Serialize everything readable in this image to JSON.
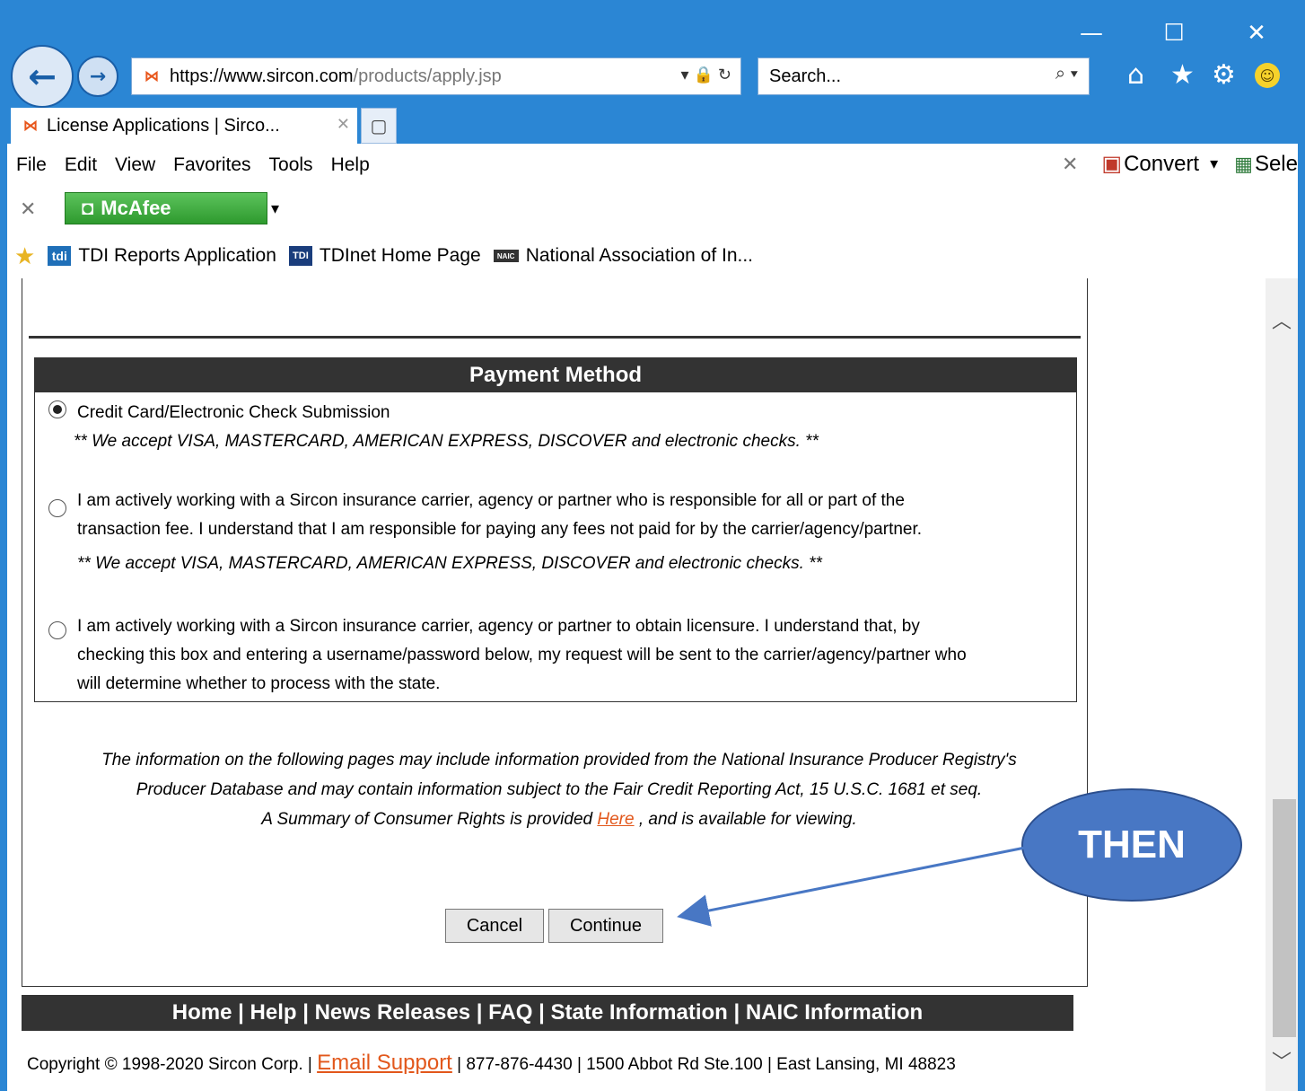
{
  "window": {
    "minimize_glyph": "—",
    "maximize_glyph": "☐",
    "close_glyph": "✕"
  },
  "nav": {
    "back_glyph": "←",
    "forward_glyph": "→",
    "url_domain": "https://www.sircon.com",
    "url_path": "/products/apply.jsp",
    "address_icons": "▾ 🔒 ↻",
    "search_placeholder": "Search...",
    "search_icon": "⌕ ▾",
    "home_icon": "⌂",
    "star_icon": "★",
    "gear_icon": "⚙",
    "smiley_icon": "☺"
  },
  "tab": {
    "title": "License Applications | Sirco...",
    "close_glyph": "✕",
    "new_tab_glyph": "▢"
  },
  "menu": {
    "file": "File",
    "edit": "Edit",
    "view": "View",
    "favorites": "Favorites",
    "tools": "Tools",
    "help": "Help",
    "x_glyph": "✕",
    "convert": "Convert",
    "convert_arrow": "▾",
    "select": "Sele"
  },
  "mcafee": {
    "x_glyph": "✕",
    "label": "McAfee",
    "arrow": "▾"
  },
  "favorites": [
    {
      "label": "TDI Reports Application"
    },
    {
      "label": "TDInet Home Page"
    },
    {
      "label": "National Association of In..."
    }
  ],
  "payment": {
    "title": "Payment Method",
    "options": [
      {
        "selected": true,
        "text": "Credit Card/Electronic Check Submission",
        "note": "** We accept VISA, MASTERCARD, AMERICAN EXPRESS, DISCOVER and electronic checks. **"
      },
      {
        "selected": false,
        "line1": "I am actively working with a Sircon insurance carrier, agency or partner who is responsible for all or part of the",
        "line2": "transaction fee. I understand that I am responsible for paying any fees not paid for by the carrier/agency/partner.",
        "note": "** We accept VISA, MASTERCARD, AMERICAN EXPRESS, DISCOVER and electronic checks. **"
      },
      {
        "selected": false,
        "line1": "I am actively working with a Sircon insurance carrier, agency or partner to obtain licensure. I understand that, by",
        "line2": "checking this box and entering a username/password below, my request will be sent to the carrier/agency/partner who",
        "line3": "will determine whether to process with the state."
      }
    ]
  },
  "notice": {
    "line1": "The information on the following pages may include information provided from the National Insurance Producer Registry's",
    "line2": "Producer Database and may contain information subject to the Fair Credit Reporting Act, 15 U.S.C. 1681 et seq.",
    "line3_pre": "A Summary of Consumer Rights is provided",
    "link": "Here",
    "line3_post": ", and is available for viewing."
  },
  "buttons": {
    "cancel": "Cancel",
    "continue": "Continue"
  },
  "footer": {
    "nav": "Home | Help | News Releases | FAQ | State Information | NAIC Information",
    "copy_pre": "Copyright © 1998-2020 Sircon Corp. |",
    "email": "Email Support",
    "copy_post": "| 877-876-4430 | 1500 Abbot Rd Ste.100 | East Lansing, MI 48823"
  },
  "annotation": {
    "label": "THEN"
  },
  "scrollbar": {
    "up_glyph": "︿",
    "down_glyph": "﹀"
  },
  "colors": {
    "chrome": "#2b86d4",
    "header_bg": "#333333",
    "link": "#e2571b",
    "annotation": "#4877c4"
  }
}
